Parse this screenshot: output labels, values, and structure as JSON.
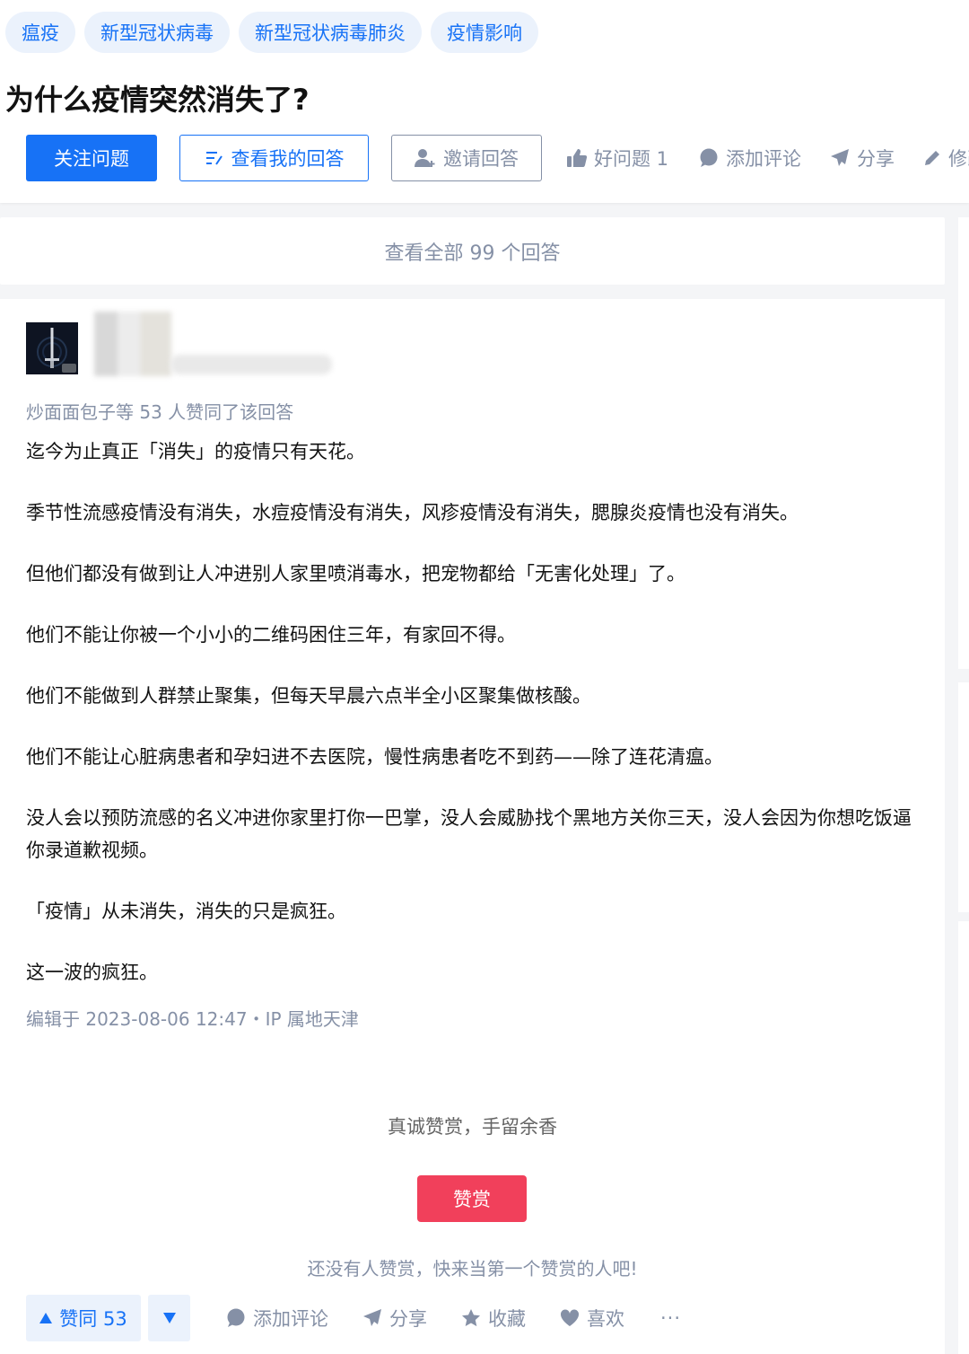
{
  "topics": [
    "瘟疫",
    "新型冠状病毒",
    "新型冠状病毒肺炎",
    "疫情影响"
  ],
  "question": {
    "title": "为什么疫情突然消失了?"
  },
  "actions": {
    "follow": "关注问题",
    "my_answer": "查看我的回答",
    "invite": "邀请回答",
    "good_question": "好问题 1",
    "comment": "添加评论",
    "share": "分享",
    "edit": "修改"
  },
  "view_all": "查看全部 99 个回答",
  "answer": {
    "voters": "炒面面包子等 53 人赞同了该回答",
    "paragraphs": [
      "迄今为止真正「消失」的疫情只有天花。",
      "季节性流感疫情没有消失，水痘疫情没有消失，风疹疫情没有消失，腮腺炎疫情也没有消失。",
      "但他们都没有做到让人冲进别人家里喷消毒水，把宠物都给「无害化处理」了。",
      "他们不能让你被一个小小的二维码困住三年，有家回不得。",
      "他们不能做到人群禁止聚集，但每天早晨六点半全小区聚集做核酸。",
      "他们不能让心脏病患者和孕妇进不去医院，慢性病患者吃不到药——除了连花清瘟。",
      "没人会以预防流感的名义冲进你家里打你一巴掌，没人会威胁找个黑地方关你三天，没人会因为你想吃饭逼你录道歉视频。",
      "「疫情」从未消失，消失的只是疯狂。",
      "这一波的疯狂。"
    ],
    "edited": "编辑于 2023-08-06 12:47・IP 属地天津"
  },
  "reward": {
    "title": "真诚赞赏，手留余香",
    "button": "赞赏",
    "note": "还没有人赞赏，快来当第一个赞赏的人吧!"
  },
  "footer": {
    "upvote": "赞同 53",
    "comment": "添加评论",
    "share": "分享",
    "collect": "收藏",
    "like": "喜欢",
    "more": "···"
  },
  "colors": {
    "brand_blue": "#1772f6",
    "tag_bg": "#ebf2fc",
    "muted": "#8590a6",
    "reward_red": "#f1405b"
  },
  "icons": [
    "list-pen-icon",
    "user-plus-icon",
    "thumb-up-icon",
    "comment-bubble-icon",
    "paper-plane-icon",
    "pencil-icon",
    "triangle-up-icon",
    "triangle-down-icon",
    "star-icon",
    "heart-icon"
  ]
}
